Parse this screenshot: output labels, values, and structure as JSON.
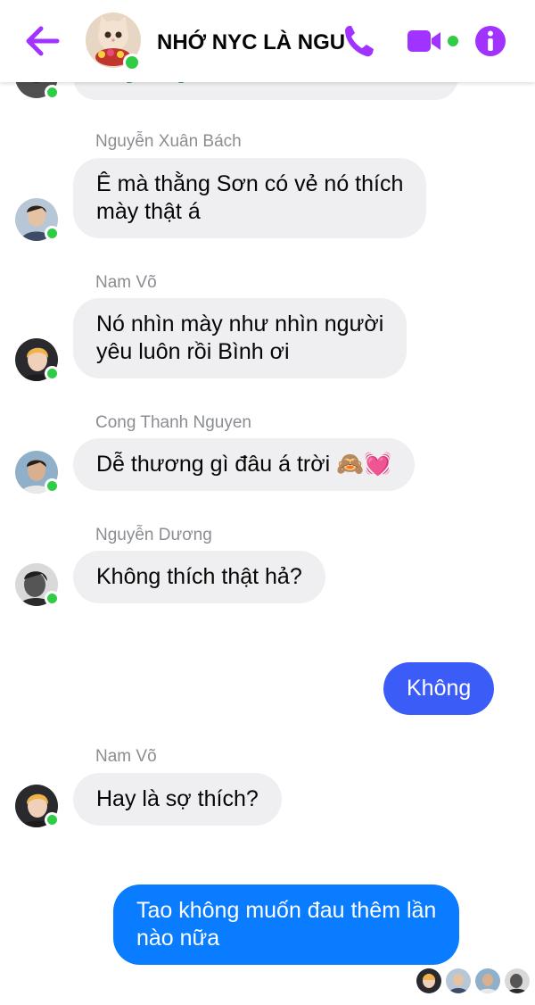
{
  "header": {
    "title": "NHỚ NYC LÀ NGU",
    "colors": {
      "accent": "#a033ff",
      "online": "#31cc46"
    }
  },
  "messages": [
    {
      "sender": "Nguyễn Xuân Bách",
      "text_lines": [
        "Ê mà thằng Sơn có vẻ nó thích",
        "mày thật á"
      ]
    },
    {
      "sender": "Nam Võ",
      "text_lines": [
        "Nó nhìn mày như nhìn người",
        "yêu luôn rồi Bình ơi"
      ]
    },
    {
      "sender": "Cong Thanh Nguyen",
      "text": "Dễ thương gì đâu á trời",
      "emoji": "🙈💓"
    },
    {
      "sender": "Nguyễn Dương",
      "text": "Không thích thật hả?"
    },
    {
      "sender": "me",
      "text": "Không"
    },
    {
      "sender": "Nam Võ",
      "text": "Hay là sợ thích?"
    },
    {
      "sender": "me",
      "text_lines": [
        "Tao không muốn đau thêm lần",
        "nào nữa"
      ]
    }
  ],
  "colors": {
    "incoming_bubble": "#efeff1",
    "outgoing_bubble_1": "#3b5cf6",
    "outgoing_bubble_2": "#0a7cff",
    "sender_name": "#8a8d91"
  }
}
